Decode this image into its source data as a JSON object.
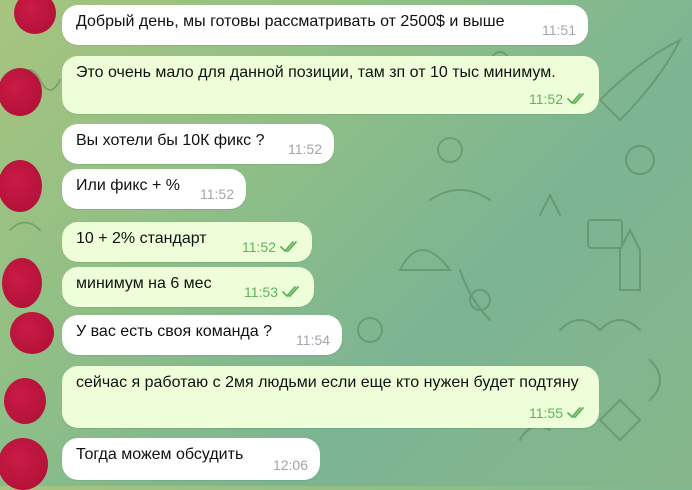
{
  "colors": {
    "incoming_bubble": "#ffffff",
    "outgoing_bubble": "#eefed9",
    "incoming_time": "#a1a7ad",
    "outgoing_time": "#5fb35a",
    "avatar": "#b5123a"
  },
  "icons": {
    "read_receipt": "double-check-icon",
    "avatar": "avatar"
  },
  "messages": [
    {
      "direction": "in",
      "text": "Добрый день, мы готовы рассматривать от 2500$ и выше",
      "time": "11:51"
    },
    {
      "direction": "out",
      "text": "Это очень мало для данной позиции, там зп от 10 тыс минимум.",
      "time": "11:52"
    },
    {
      "direction": "in",
      "text": "Вы хотели бы 10К фикс ?",
      "time": "11:52"
    },
    {
      "direction": "in",
      "text": "Или фикс + %",
      "time": "11:52"
    },
    {
      "direction": "out",
      "text": "10 + 2% стандарт",
      "time": "11:52"
    },
    {
      "direction": "out",
      "text": "минимум на 6 мес",
      "time": "11:53"
    },
    {
      "direction": "in",
      "text": "У вас есть своя команда ?",
      "time": "11:54"
    },
    {
      "direction": "out",
      "text": "сейчас я работаю с 2мя людьми если еще кто нужен будет подтяну",
      "time": "11:55"
    },
    {
      "direction": "in",
      "text": "Тогда можем обсудить",
      "time": "12:06"
    }
  ]
}
